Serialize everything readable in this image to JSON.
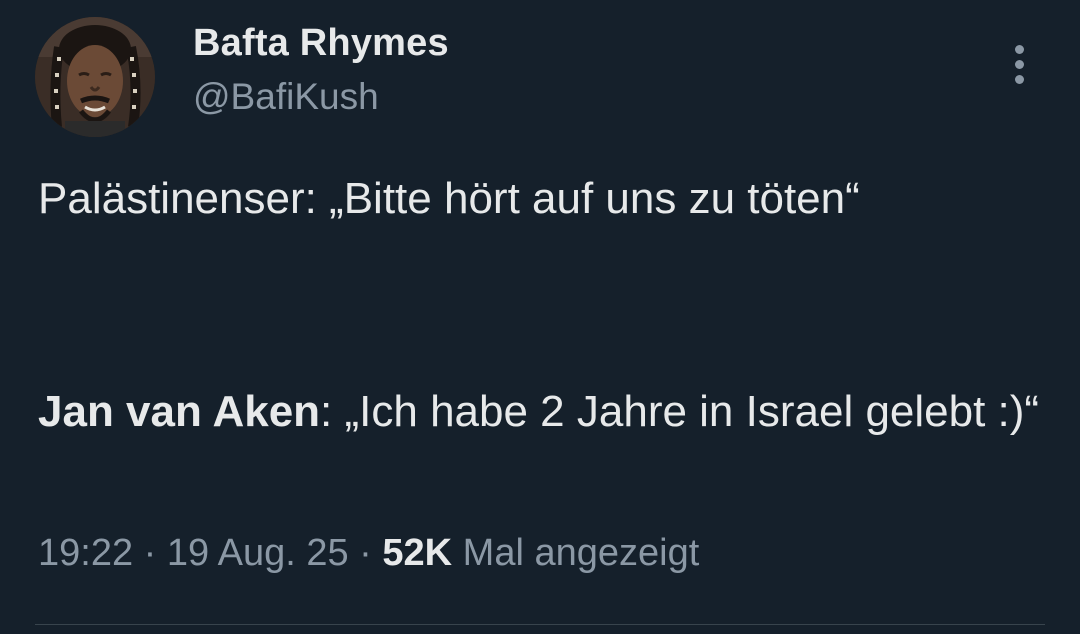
{
  "author": {
    "name": "Bafta Rhymes",
    "handle": "@BafiKush",
    "avatar_icon": "profile-photo"
  },
  "more_icon": "more-options-vertical-icon",
  "tweet": {
    "para1": "Palästinenser: „Bitte hört auf uns zu töten“",
    "para2_bold": "Jan van Aken",
    "para2_rest": ": „Ich habe 2 Jahre in Israel gelebt :)“"
  },
  "meta": {
    "time": "19:22",
    "sep1": " · ",
    "date": "19 Aug. 25",
    "sep2": " · ",
    "views_count": "52K",
    "views_label": " Mal angezeigt"
  },
  "colors": {
    "background": "#15202b",
    "text_primary": "#e7e9ea",
    "text_secondary": "#8b98a5",
    "divider": "#38444d"
  }
}
